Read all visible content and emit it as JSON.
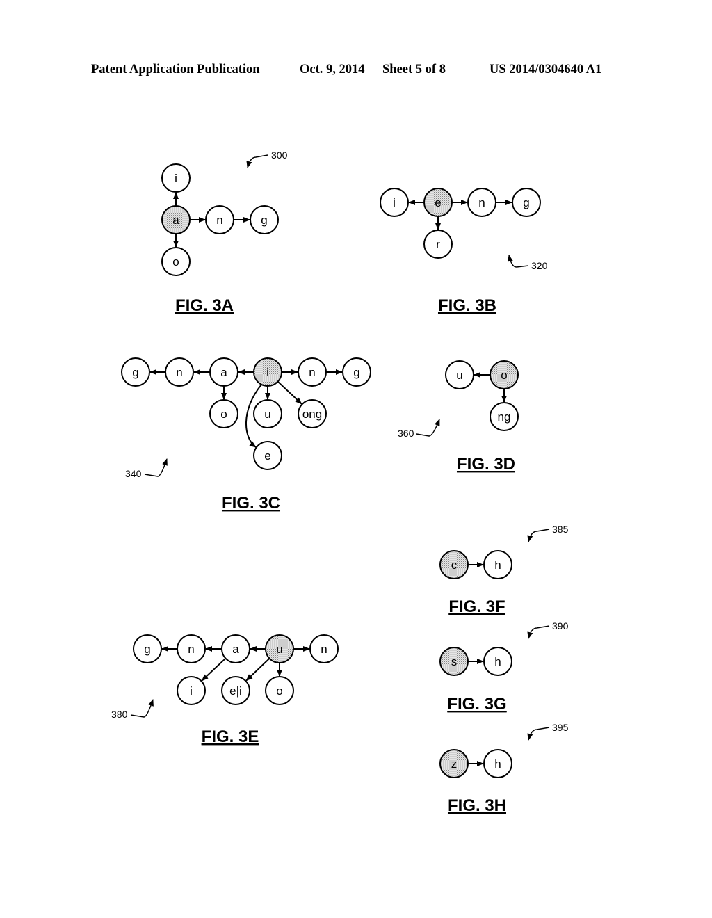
{
  "header": {
    "publication": "Patent Application Publication",
    "date": "Oct. 9, 2014",
    "sheet": "Sheet 5 of 8",
    "number": "US 2014/0304640 A1"
  },
  "colors": {
    "ink": "#000000",
    "root_fill": "#d4d4d4",
    "node_fill": "#ffffff"
  },
  "figures": [
    {
      "id": "3A",
      "title": "FIG. 3A",
      "ref": "300",
      "nodes": [
        {
          "id": "a",
          "label": "a",
          "root": true
        },
        {
          "id": "i",
          "label": "i"
        },
        {
          "id": "n",
          "label": "n"
        },
        {
          "id": "g",
          "label": "g"
        },
        {
          "id": "o",
          "label": "o"
        }
      ],
      "edges": [
        [
          "a",
          "i"
        ],
        [
          "a",
          "n"
        ],
        [
          "n",
          "g"
        ],
        [
          "a",
          "o"
        ]
      ]
    },
    {
      "id": "3B",
      "title": "FIG. 3B",
      "ref": "320",
      "nodes": [
        {
          "id": "e",
          "label": "e",
          "root": true
        },
        {
          "id": "i",
          "label": "i"
        },
        {
          "id": "n",
          "label": "n"
        },
        {
          "id": "g",
          "label": "g"
        },
        {
          "id": "r",
          "label": "r"
        }
      ],
      "edges": [
        [
          "e",
          "i"
        ],
        [
          "e",
          "n"
        ],
        [
          "n",
          "g"
        ],
        [
          "e",
          "r"
        ]
      ]
    },
    {
      "id": "3C",
      "title": "FIG. 3C",
      "ref": "340",
      "nodes": [
        {
          "id": "i",
          "label": "i",
          "root": true
        },
        {
          "id": "a",
          "label": "a"
        },
        {
          "id": "n1",
          "label": "n"
        },
        {
          "id": "g1",
          "label": "g"
        },
        {
          "id": "n2",
          "label": "n"
        },
        {
          "id": "g2",
          "label": "g"
        },
        {
          "id": "o",
          "label": "o"
        },
        {
          "id": "u",
          "label": "u"
        },
        {
          "id": "ong",
          "label": "ong"
        },
        {
          "id": "e",
          "label": "e"
        }
      ],
      "edges": [
        [
          "i",
          "a"
        ],
        [
          "a",
          "n1"
        ],
        [
          "n1",
          "g1"
        ],
        [
          "i",
          "n2"
        ],
        [
          "n2",
          "g2"
        ],
        [
          "a",
          "o"
        ],
        [
          "i",
          "u"
        ],
        [
          "i",
          "ong"
        ],
        [
          "i",
          "e"
        ]
      ]
    },
    {
      "id": "3D",
      "title": "FIG. 3D",
      "ref": "360",
      "nodes": [
        {
          "id": "o",
          "label": "o",
          "root": true
        },
        {
          "id": "u",
          "label": "u"
        },
        {
          "id": "ng",
          "label": "ng"
        }
      ],
      "edges": [
        [
          "o",
          "u"
        ],
        [
          "o",
          "ng"
        ]
      ]
    },
    {
      "id": "3E",
      "title": "FIG. 3E",
      "ref": "380",
      "nodes": [
        {
          "id": "u",
          "label": "u",
          "root": true
        },
        {
          "id": "a",
          "label": "a"
        },
        {
          "id": "n1",
          "label": "n"
        },
        {
          "id": "g",
          "label": "g"
        },
        {
          "id": "n2",
          "label": "n"
        },
        {
          "id": "i",
          "label": "i"
        },
        {
          "id": "ei",
          "label": "e|i"
        },
        {
          "id": "o",
          "label": "o"
        }
      ],
      "edges": [
        [
          "u",
          "a"
        ],
        [
          "a",
          "n1"
        ],
        [
          "n1",
          "g"
        ],
        [
          "u",
          "n2"
        ],
        [
          "a",
          "i"
        ],
        [
          "u",
          "ei"
        ],
        [
          "u",
          "o"
        ]
      ]
    },
    {
      "id": "3F",
      "title": "FIG. 3F",
      "ref": "385",
      "nodes": [
        {
          "id": "c",
          "label": "c",
          "root": true
        },
        {
          "id": "h",
          "label": "h"
        }
      ],
      "edges": [
        [
          "c",
          "h"
        ]
      ]
    },
    {
      "id": "3G",
      "title": "FIG. 3G",
      "ref": "390",
      "nodes": [
        {
          "id": "s",
          "label": "s",
          "root": true
        },
        {
          "id": "h",
          "label": "h"
        }
      ],
      "edges": [
        [
          "s",
          "h"
        ]
      ]
    },
    {
      "id": "3H",
      "title": "FIG. 3H",
      "ref": "395",
      "nodes": [
        {
          "id": "z",
          "label": "z",
          "root": true
        },
        {
          "id": "h",
          "label": "h"
        }
      ],
      "edges": [
        [
          "z",
          "h"
        ]
      ]
    }
  ]
}
